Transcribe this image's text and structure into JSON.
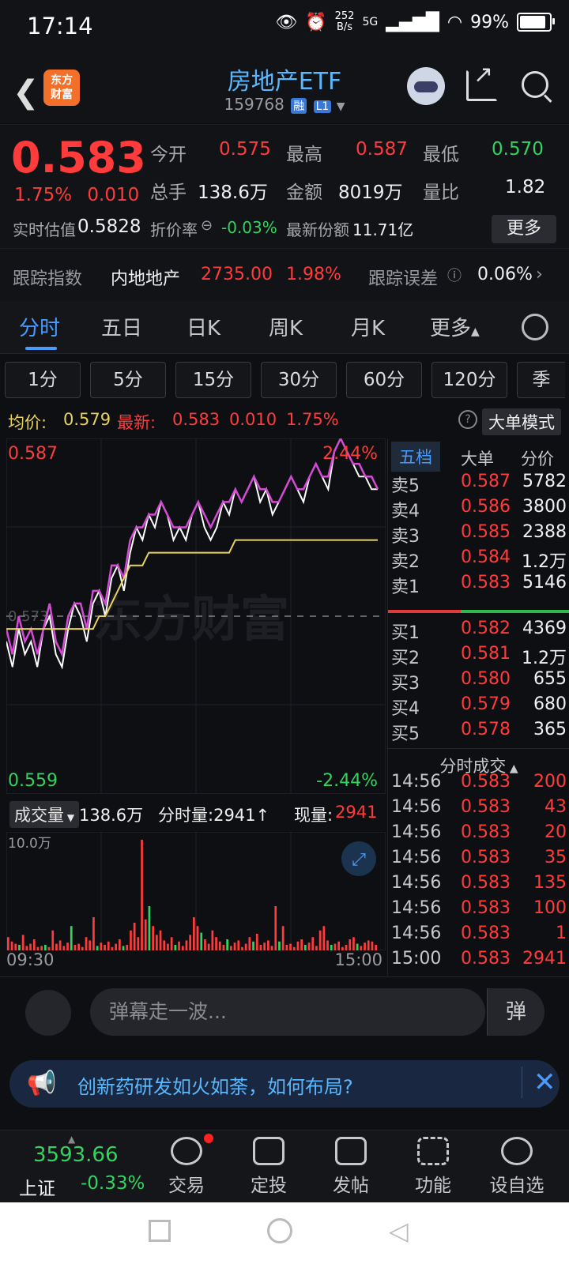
{
  "status": {
    "time": "17:14",
    "net_speed": "252",
    "net_unit": "B/s",
    "signal": "5G",
    "battery": "99%"
  },
  "header": {
    "title": "房地产ETF",
    "code": "159768",
    "tag1": "融",
    "tag2": "L1",
    "logo_line1": "东方",
    "logo_line2": "财富"
  },
  "quote": {
    "price": "0.583",
    "change_pct": "1.75%",
    "change": "0.010",
    "open_label": "今开",
    "open": "0.575",
    "high_label": "最高",
    "high": "0.587",
    "low_label": "最低",
    "low": "0.570",
    "volume_label": "总手",
    "volume": "138.6万",
    "amount_label": "金额",
    "amount": "8019万",
    "ratio_label": "量比",
    "ratio": "1.82",
    "iopv_label": "实时估值",
    "iopv": "0.5828",
    "premium_label": "折价率",
    "premium": "-0.03%",
    "shares_label": "最新份额",
    "shares": "11.71亿",
    "more": "更多"
  },
  "track": {
    "label": "跟踪指数",
    "index": "内地地产",
    "value": "2735.00",
    "pct": "1.98%",
    "err_label": "跟踪误差",
    "err": "0.06%"
  },
  "tabs": [
    "分时",
    "五日",
    "日K",
    "周K",
    "月K",
    "更多"
  ],
  "periods": [
    "1分",
    "5分",
    "15分",
    "30分",
    "60分",
    "120分",
    "季"
  ],
  "avgline": {
    "avg_label": "均价:",
    "avg": "0.579",
    "last_label": "最新:",
    "last": "0.583",
    "chg": "0.010",
    "pct": "1.75%",
    "mode": "大单模式"
  },
  "chart_data": {
    "type": "line",
    "title": "",
    "x": [
      "09:30",
      "15:00"
    ],
    "ylim": [
      0.559,
      0.587
    ],
    "y_top_label": "0.587",
    "y_bottom_label": "0.559",
    "pct_top": "2.44%",
    "pct_bottom": "-2.44%",
    "prev_close": 0.573,
    "prev_close_label": "0.573",
    "watermark": "东方财富",
    "series": [
      {
        "color": "#ffffff",
        "values": [
          0.571,
          0.569,
          0.572,
          0.57,
          0.571,
          0.569,
          0.572,
          0.573,
          0.57,
          0.569,
          0.572,
          0.574,
          0.573,
          0.571,
          0.574,
          0.575,
          0.573,
          0.576,
          0.577,
          0.575,
          0.578,
          0.58,
          0.579,
          0.581,
          0.58,
          0.582,
          0.581,
          0.579,
          0.58,
          0.579,
          0.581,
          0.582,
          0.58,
          0.579,
          0.58,
          0.582,
          0.581,
          0.583,
          0.582,
          0.583,
          0.584,
          0.582,
          0.583,
          0.581,
          0.582,
          0.583,
          0.584,
          0.583,
          0.582,
          0.584,
          0.585,
          0.584,
          0.583,
          0.586,
          0.587,
          0.586,
          0.585,
          0.584,
          0.584,
          0.583,
          0.583
        ]
      },
      {
        "color": "#d24bd2",
        "values": [
          0.572,
          0.57,
          0.573,
          0.571,
          0.572,
          0.57,
          0.572,
          0.574,
          0.571,
          0.57,
          0.573,
          0.574,
          0.574,
          0.572,
          0.575,
          0.575,
          0.574,
          0.577,
          0.577,
          0.576,
          0.579,
          0.58,
          0.58,
          0.581,
          0.581,
          0.582,
          0.581,
          0.58,
          0.58,
          0.58,
          0.581,
          0.582,
          0.581,
          0.58,
          0.581,
          0.582,
          0.582,
          0.583,
          0.582,
          0.583,
          0.584,
          0.583,
          0.583,
          0.582,
          0.582,
          0.583,
          0.584,
          0.583,
          0.583,
          0.584,
          0.585,
          0.584,
          0.584,
          0.586,
          0.587,
          0.586,
          0.585,
          0.585,
          0.584,
          0.584,
          0.583
        ]
      },
      {
        "color": "#e8d35a",
        "values": [
          0.572,
          0.572,
          0.572,
          0.572,
          0.572,
          0.572,
          0.572,
          0.572,
          0.572,
          0.572,
          0.572,
          0.572,
          0.572,
          0.572,
          0.572,
          0.573,
          0.573,
          0.574,
          0.575,
          0.576,
          0.577,
          0.577,
          0.577,
          0.578,
          0.578,
          0.578,
          0.578,
          0.578,
          0.578,
          0.578,
          0.578,
          0.578,
          0.578,
          0.578,
          0.578,
          0.578,
          0.578,
          0.579,
          0.579,
          0.579,
          0.579,
          0.579,
          0.579,
          0.579,
          0.579,
          0.579,
          0.579,
          0.579,
          0.579,
          0.579,
          0.579,
          0.579,
          0.579,
          0.579,
          0.579,
          0.579,
          0.579,
          0.579,
          0.579,
          0.579,
          0.579
        ]
      }
    ]
  },
  "volume": {
    "selector": "成交量",
    "total": "138.6万",
    "minute_label": "分时量:",
    "minute": "2941",
    "now_label": "现量:",
    "now": "2941",
    "scale": "10.0万",
    "start": "09:30",
    "end": "15:00",
    "bars": [
      12,
      8,
      6,
      5,
      14,
      4,
      6,
      10,
      3,
      4,
      5,
      3,
      18,
      6,
      9,
      4,
      7,
      22,
      5,
      6,
      3,
      12,
      9,
      30,
      4,
      7,
      5,
      8,
      3,
      6,
      10,
      4,
      5,
      18,
      25,
      12,
      100,
      28,
      40,
      22,
      14,
      18,
      9,
      6,
      12,
      5,
      8,
      4,
      9,
      14,
      30,
      22,
      16,
      10,
      6,
      18,
      12,
      8,
      5,
      10,
      4,
      7,
      9,
      3,
      6,
      12,
      8,
      15,
      5,
      7,
      9,
      4,
      40,
      8,
      22,
      5,
      6,
      3,
      8,
      10,
      5,
      7,
      12,
      4,
      18,
      22,
      9,
      5,
      6,
      8,
      3,
      5,
      10,
      12,
      6,
      4,
      7,
      9,
      8,
      5
    ],
    "bar_colors": [
      "#ff3b3b",
      "#32d35f"
    ]
  },
  "book": {
    "tabs": [
      "五档",
      "大单",
      "分价"
    ],
    "asks": [
      {
        "name": "卖5",
        "price": "0.587",
        "vol": "5782"
      },
      {
        "name": "卖4",
        "price": "0.586",
        "vol": "3800"
      },
      {
        "name": "卖3",
        "price": "0.585",
        "vol": "2388"
      },
      {
        "name": "卖2",
        "price": "0.584",
        "vol": "1.2万"
      },
      {
        "name": "卖1",
        "price": "0.583",
        "vol": "5146"
      }
    ],
    "bids": [
      {
        "name": "买1",
        "price": "0.582",
        "vol": "4369"
      },
      {
        "name": "买2",
        "price": "0.581",
        "vol": "1.2万"
      },
      {
        "name": "买3",
        "price": "0.580",
        "vol": "655"
      },
      {
        "name": "买4",
        "price": "0.579",
        "vol": "680"
      },
      {
        "name": "买5",
        "price": "0.578",
        "vol": "365"
      }
    ],
    "ticks_title": "分时成交",
    "ticks": [
      {
        "t": "14:56",
        "p": "0.583",
        "v": "200"
      },
      {
        "t": "14:56",
        "p": "0.583",
        "v": "43"
      },
      {
        "t": "14:56",
        "p": "0.583",
        "v": "20"
      },
      {
        "t": "14:56",
        "p": "0.583",
        "v": "35"
      },
      {
        "t": "14:56",
        "p": "0.583",
        "v": "135"
      },
      {
        "t": "14:56",
        "p": "0.583",
        "v": "100"
      },
      {
        "t": "14:56",
        "p": "0.583",
        "v": "1"
      },
      {
        "t": "15:00",
        "p": "0.583",
        "v": "2941"
      }
    ]
  },
  "danmu": {
    "placeholder": "弹幕走一波...",
    "send": "弹"
  },
  "notice": {
    "text": "创新药研发如火如荼，如何布局?"
  },
  "bottom": {
    "index_value": "3593.66",
    "index_name": "上证",
    "index_pct": "-0.33%",
    "items": [
      "交易",
      "定投",
      "发帖",
      "功能",
      "设自选"
    ]
  }
}
